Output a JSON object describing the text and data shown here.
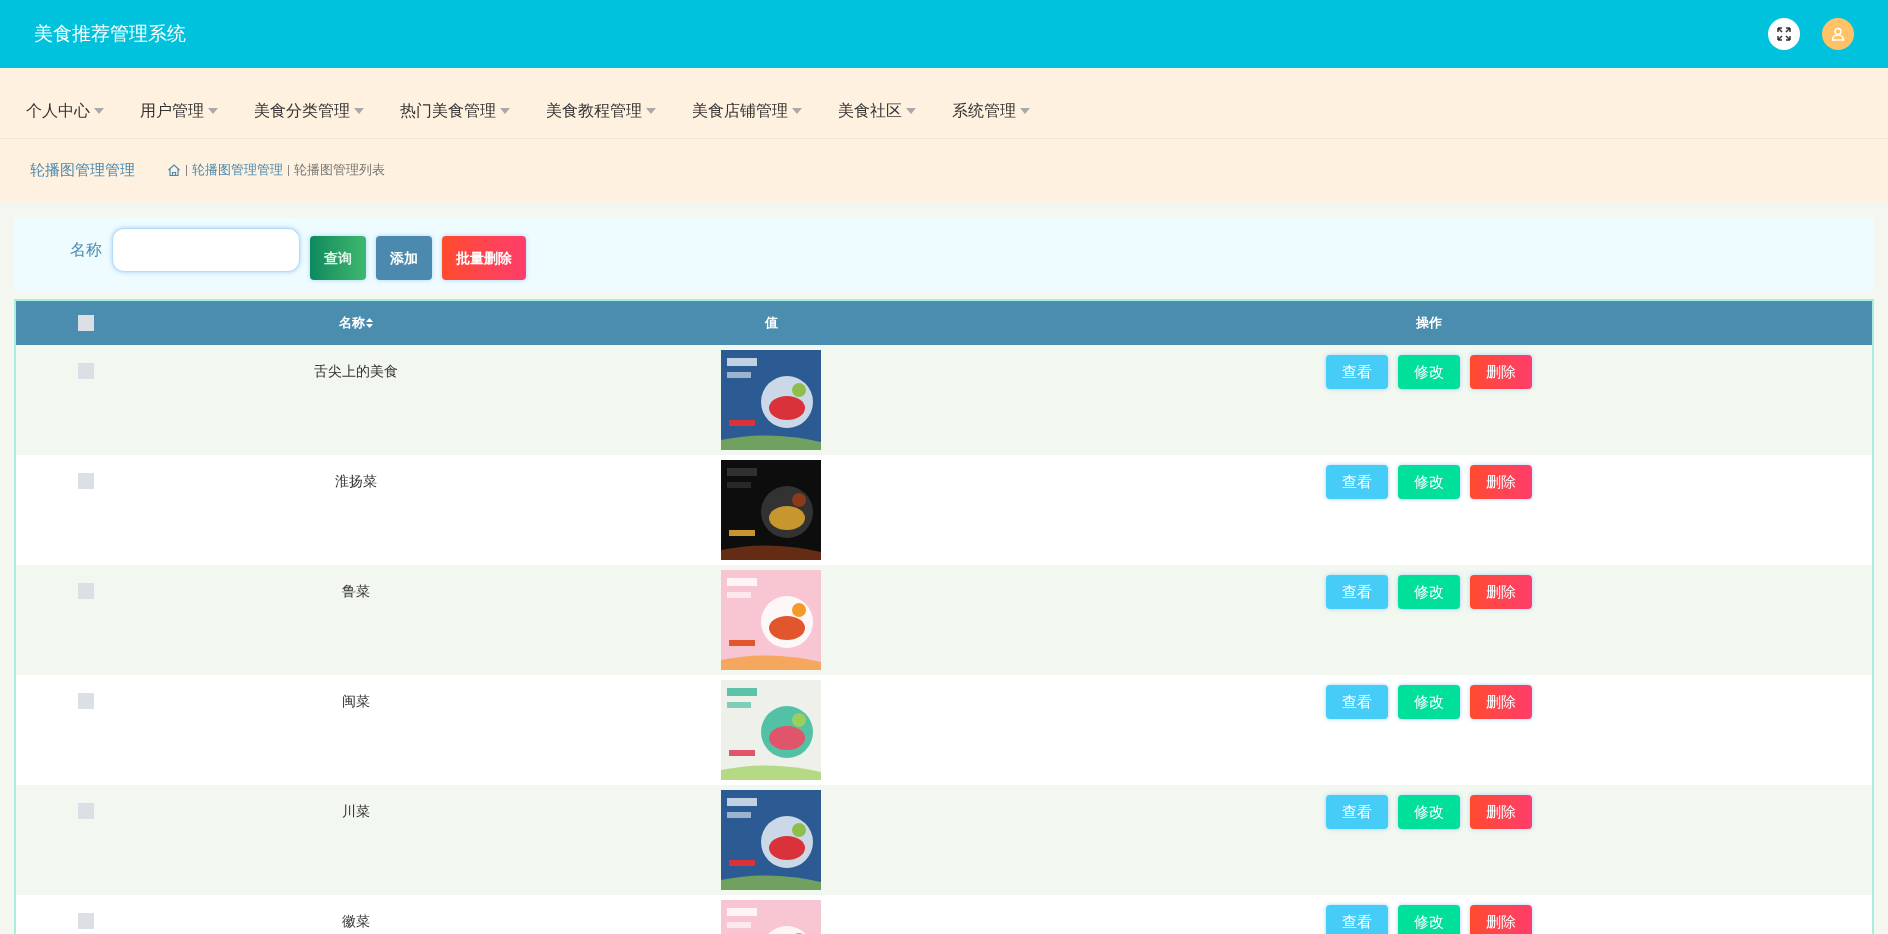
{
  "header": {
    "title": "美食推荐管理系统"
  },
  "nav": [
    {
      "label": "个人中心"
    },
    {
      "label": "用户管理"
    },
    {
      "label": "美食分类管理"
    },
    {
      "label": "热门美食管理"
    },
    {
      "label": "美食教程管理"
    },
    {
      "label": "美食店铺管理"
    },
    {
      "label": "美食社区"
    },
    {
      "label": "系统管理"
    }
  ],
  "breadcrumb": {
    "page_title": "轮播图管理管理",
    "path": [
      "轮播图管理管理",
      "轮播图管理列表"
    ]
  },
  "search": {
    "label": "名称",
    "buttons": [
      {
        "kind": "query",
        "label": "查询"
      },
      {
        "kind": "add",
        "label": "添加"
      },
      {
        "kind": "batch_delete",
        "label": "批量删除"
      }
    ]
  },
  "table": {
    "select_all": {
      "checked": false
    },
    "columns": [
      "名称",
      "值",
      "操作"
    ],
    "rows": [
      {
        "checked": false,
        "name": "舌尖上的美食",
        "actions": [
          "查看",
          "修改",
          "删除"
        ]
      },
      {
        "checked": false,
        "name": "淮扬菜",
        "actions": [
          "查看",
          "修改",
          "删除"
        ]
      },
      {
        "checked": false,
        "name": "鲁菜",
        "actions": [
          "查看",
          "修改",
          "删除"
        ]
      },
      {
        "checked": false,
        "name": "闽菜",
        "actions": [
          "查看",
          "修改",
          "删除"
        ]
      },
      {
        "checked": false,
        "name": "川菜",
        "actions": [
          "查看",
          "修改",
          "删除"
        ]
      },
      {
        "checked": false,
        "name": "徽菜",
        "actions": [
          "查看",
          "修改",
          "删除"
        ]
      }
    ]
  }
}
